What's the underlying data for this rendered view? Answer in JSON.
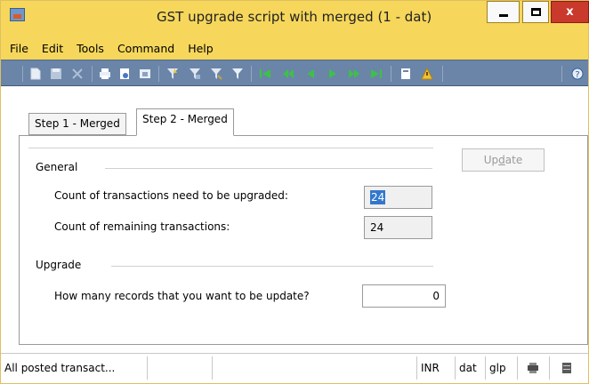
{
  "window": {
    "title": "GST upgrade script with merged (1 - dat)",
    "minimize_glyph": "–",
    "close_glyph": "x"
  },
  "menu": [
    "File",
    "Edit",
    "Tools",
    "Command",
    "Help"
  ],
  "toolbar_icons": [
    "new-icon",
    "save-icon",
    "delete-icon",
    "print-icon",
    "print-preview-icon",
    "export-icon",
    "filter-by-selection-icon",
    "filter-by-form-icon",
    "advanced-filter-icon",
    "remove-filter-icon",
    "first-record-icon",
    "previous-page-icon",
    "previous-record-icon",
    "next-record-icon",
    "next-page-icon",
    "last-record-icon",
    "attachment-icon",
    "alert-icon",
    "help-icon"
  ],
  "tabs": [
    {
      "label": "Step 1 - Merged",
      "active": false
    },
    {
      "label": "Step 2 - Merged",
      "active": true
    }
  ],
  "general": {
    "title": "General",
    "count_label": "Count of transactions need to be upgraded:",
    "count_value": "24",
    "remaining_label": "Count of remaining transactions:",
    "remaining_value": "24"
  },
  "upgrade": {
    "title": "Upgrade",
    "records_label": "How many records that you want to be update?",
    "records_value": "0"
  },
  "update_button": {
    "label_pre": "Up",
    "label_access": "d",
    "label_post": "ate"
  },
  "status": {
    "message": "All posted transact...",
    "currency": "INR",
    "company": "dat",
    "extra": "glp"
  },
  "colors": {
    "titlebar": "#f6d75c",
    "toolbar": "#6a85a8",
    "close_button": "#c9392c",
    "selection": "#3377cc"
  }
}
